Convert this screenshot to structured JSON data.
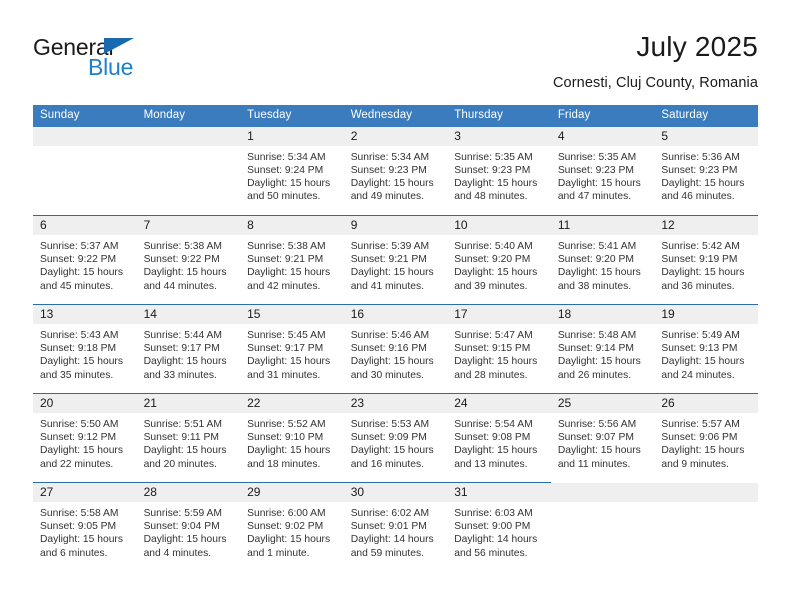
{
  "brand": {
    "line1": "General",
    "line2": "Blue",
    "flag_icon": "triangle-flag-icon",
    "brand_blue": "#1d7fd0",
    "flag_color": "#1869b0"
  },
  "header": {
    "title": "July 2025",
    "subtitle": "Cornesti, Cluj County, Romania"
  },
  "theme": {
    "header_bg": "#3b7cbe",
    "row_divider": "#2b6cad",
    "daynum_bg": "#efefef",
    "text": "#333333"
  },
  "weekday_headers": [
    "Sunday",
    "Monday",
    "Tuesday",
    "Wednesday",
    "Thursday",
    "Friday",
    "Saturday"
  ],
  "weeks": [
    [
      {
        "day": "",
        "sunrise": "",
        "sunset": "",
        "daylight_1": "",
        "daylight_2": ""
      },
      {
        "day": "",
        "sunrise": "",
        "sunset": "",
        "daylight_1": "",
        "daylight_2": ""
      },
      {
        "day": "1",
        "sunrise": "Sunrise: 5:34 AM",
        "sunset": "Sunset: 9:24 PM",
        "daylight_1": "Daylight: 15 hours",
        "daylight_2": "and 50 minutes."
      },
      {
        "day": "2",
        "sunrise": "Sunrise: 5:34 AM",
        "sunset": "Sunset: 9:23 PM",
        "daylight_1": "Daylight: 15 hours",
        "daylight_2": "and 49 minutes."
      },
      {
        "day": "3",
        "sunrise": "Sunrise: 5:35 AM",
        "sunset": "Sunset: 9:23 PM",
        "daylight_1": "Daylight: 15 hours",
        "daylight_2": "and 48 minutes."
      },
      {
        "day": "4",
        "sunrise": "Sunrise: 5:35 AM",
        "sunset": "Sunset: 9:23 PM",
        "daylight_1": "Daylight: 15 hours",
        "daylight_2": "and 47 minutes."
      },
      {
        "day": "5",
        "sunrise": "Sunrise: 5:36 AM",
        "sunset": "Sunset: 9:23 PM",
        "daylight_1": "Daylight: 15 hours",
        "daylight_2": "and 46 minutes."
      }
    ],
    [
      {
        "day": "6",
        "sunrise": "Sunrise: 5:37 AM",
        "sunset": "Sunset: 9:22 PM",
        "daylight_1": "Daylight: 15 hours",
        "daylight_2": "and 45 minutes."
      },
      {
        "day": "7",
        "sunrise": "Sunrise: 5:38 AM",
        "sunset": "Sunset: 9:22 PM",
        "daylight_1": "Daylight: 15 hours",
        "daylight_2": "and 44 minutes."
      },
      {
        "day": "8",
        "sunrise": "Sunrise: 5:38 AM",
        "sunset": "Sunset: 9:21 PM",
        "daylight_1": "Daylight: 15 hours",
        "daylight_2": "and 42 minutes."
      },
      {
        "day": "9",
        "sunrise": "Sunrise: 5:39 AM",
        "sunset": "Sunset: 9:21 PM",
        "daylight_1": "Daylight: 15 hours",
        "daylight_2": "and 41 minutes."
      },
      {
        "day": "10",
        "sunrise": "Sunrise: 5:40 AM",
        "sunset": "Sunset: 9:20 PM",
        "daylight_1": "Daylight: 15 hours",
        "daylight_2": "and 39 minutes."
      },
      {
        "day": "11",
        "sunrise": "Sunrise: 5:41 AM",
        "sunset": "Sunset: 9:20 PM",
        "daylight_1": "Daylight: 15 hours",
        "daylight_2": "and 38 minutes."
      },
      {
        "day": "12",
        "sunrise": "Sunrise: 5:42 AM",
        "sunset": "Sunset: 9:19 PM",
        "daylight_1": "Daylight: 15 hours",
        "daylight_2": "and 36 minutes."
      }
    ],
    [
      {
        "day": "13",
        "sunrise": "Sunrise: 5:43 AM",
        "sunset": "Sunset: 9:18 PM",
        "daylight_1": "Daylight: 15 hours",
        "daylight_2": "and 35 minutes."
      },
      {
        "day": "14",
        "sunrise": "Sunrise: 5:44 AM",
        "sunset": "Sunset: 9:17 PM",
        "daylight_1": "Daylight: 15 hours",
        "daylight_2": "and 33 minutes."
      },
      {
        "day": "15",
        "sunrise": "Sunrise: 5:45 AM",
        "sunset": "Sunset: 9:17 PM",
        "daylight_1": "Daylight: 15 hours",
        "daylight_2": "and 31 minutes."
      },
      {
        "day": "16",
        "sunrise": "Sunrise: 5:46 AM",
        "sunset": "Sunset: 9:16 PM",
        "daylight_1": "Daylight: 15 hours",
        "daylight_2": "and 30 minutes."
      },
      {
        "day": "17",
        "sunrise": "Sunrise: 5:47 AM",
        "sunset": "Sunset: 9:15 PM",
        "daylight_1": "Daylight: 15 hours",
        "daylight_2": "and 28 minutes."
      },
      {
        "day": "18",
        "sunrise": "Sunrise: 5:48 AM",
        "sunset": "Sunset: 9:14 PM",
        "daylight_1": "Daylight: 15 hours",
        "daylight_2": "and 26 minutes."
      },
      {
        "day": "19",
        "sunrise": "Sunrise: 5:49 AM",
        "sunset": "Sunset: 9:13 PM",
        "daylight_1": "Daylight: 15 hours",
        "daylight_2": "and 24 minutes."
      }
    ],
    [
      {
        "day": "20",
        "sunrise": "Sunrise: 5:50 AM",
        "sunset": "Sunset: 9:12 PM",
        "daylight_1": "Daylight: 15 hours",
        "daylight_2": "and 22 minutes."
      },
      {
        "day": "21",
        "sunrise": "Sunrise: 5:51 AM",
        "sunset": "Sunset: 9:11 PM",
        "daylight_1": "Daylight: 15 hours",
        "daylight_2": "and 20 minutes."
      },
      {
        "day": "22",
        "sunrise": "Sunrise: 5:52 AM",
        "sunset": "Sunset: 9:10 PM",
        "daylight_1": "Daylight: 15 hours",
        "daylight_2": "and 18 minutes."
      },
      {
        "day": "23",
        "sunrise": "Sunrise: 5:53 AM",
        "sunset": "Sunset: 9:09 PM",
        "daylight_1": "Daylight: 15 hours",
        "daylight_2": "and 16 minutes."
      },
      {
        "day": "24",
        "sunrise": "Sunrise: 5:54 AM",
        "sunset": "Sunset: 9:08 PM",
        "daylight_1": "Daylight: 15 hours",
        "daylight_2": "and 13 minutes."
      },
      {
        "day": "25",
        "sunrise": "Sunrise: 5:56 AM",
        "sunset": "Sunset: 9:07 PM",
        "daylight_1": "Daylight: 15 hours",
        "daylight_2": "and 11 minutes."
      },
      {
        "day": "26",
        "sunrise": "Sunrise: 5:57 AM",
        "sunset": "Sunset: 9:06 PM",
        "daylight_1": "Daylight: 15 hours",
        "daylight_2": "and 9 minutes."
      }
    ],
    [
      {
        "day": "27",
        "sunrise": "Sunrise: 5:58 AM",
        "sunset": "Sunset: 9:05 PM",
        "daylight_1": "Daylight: 15 hours",
        "daylight_2": "and 6 minutes."
      },
      {
        "day": "28",
        "sunrise": "Sunrise: 5:59 AM",
        "sunset": "Sunset: 9:04 PM",
        "daylight_1": "Daylight: 15 hours",
        "daylight_2": "and 4 minutes."
      },
      {
        "day": "29",
        "sunrise": "Sunrise: 6:00 AM",
        "sunset": "Sunset: 9:02 PM",
        "daylight_1": "Daylight: 15 hours",
        "daylight_2": "and 1 minute."
      },
      {
        "day": "30",
        "sunrise": "Sunrise: 6:02 AM",
        "sunset": "Sunset: 9:01 PM",
        "daylight_1": "Daylight: 14 hours",
        "daylight_2": "and 59 minutes."
      },
      {
        "day": "31",
        "sunrise": "Sunrise: 6:03 AM",
        "sunset": "Sunset: 9:00 PM",
        "daylight_1": "Daylight: 14 hours",
        "daylight_2": "and 56 minutes."
      },
      {
        "day": "",
        "sunrise": "",
        "sunset": "",
        "daylight_1": "",
        "daylight_2": ""
      },
      {
        "day": "",
        "sunrise": "",
        "sunset": "",
        "daylight_1": "",
        "daylight_2": ""
      }
    ]
  ]
}
